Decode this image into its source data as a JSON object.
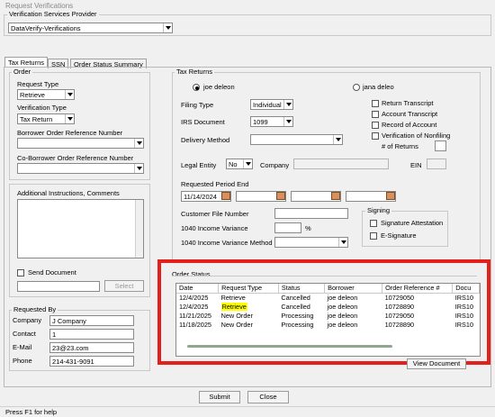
{
  "window": {
    "title": "Request Verifications"
  },
  "provider": {
    "label": "Verification Services Provider",
    "value": "DataVerify-Verifications"
  },
  "tabs": [
    {
      "label": "Tax Returns"
    },
    {
      "label": "SSN"
    },
    {
      "label": "Order Status Summary"
    }
  ],
  "order": {
    "group_label": "Order",
    "request_type_label": "Request Type",
    "request_type_value": "Retrieve",
    "verification_type_label": "Verification Type",
    "verification_type_value": "Tax Return",
    "borrower_ref_label": "Borrower Order Reference Number",
    "borrower_ref_value": "",
    "coborrower_ref_label": "Co-Borrower Order Reference Number",
    "coborrower_ref_value": ""
  },
  "instructions": {
    "label": "Additional Instructions, Comments",
    "send_document_label": "Send Document",
    "select_label": "Select"
  },
  "requested_by": {
    "label": "Requested By",
    "company_label": "Company",
    "company_value": "J Company",
    "contact_label": "Contact",
    "contact_value": "1",
    "email_label": "E-Mail",
    "email_value": "23@23.com",
    "phone_label": "Phone",
    "phone_value": "214-431-9091"
  },
  "tax_returns": {
    "group_label": "Tax Returns",
    "borrower1": "joe  deleon",
    "borrower2": "jana  deleo",
    "filing_type_label": "Filing Type",
    "filing_type_value": "Individual",
    "irs_document_label": "IRS Document",
    "irs_document_value": "1099",
    "delivery_method_label": "Delivery Method",
    "delivery_method_value": "",
    "legal_entity_label": "Legal Entity",
    "legal_entity_value": "No",
    "company_label": "Company",
    "ein_label": "EIN",
    "period_end_label": "Requested Period End",
    "period_end_value": "11/14/2024",
    "customer_file_label": "Customer File Number",
    "income_variance_label": "1040 Income Variance",
    "percent_label": "%",
    "variance_method_label": "1040 Income Variance Method",
    "checks": [
      "Return Transcript",
      "Account Transcript",
      "Record of Account",
      "Verification of Nonfiling"
    ],
    "num_returns_label": "# of Returns",
    "signing_label": "Signing",
    "signing_checks": [
      "Signature Attestation",
      "E-Signature"
    ]
  },
  "order_status": {
    "label": "Order Status",
    "columns": [
      "Date",
      "Request Type",
      "Status",
      "Borrower",
      "Order Reference #",
      "Docu"
    ],
    "rows": [
      [
        "12/4/2025",
        "Retrieve",
        "Cancelled",
        "joe deleon",
        "10729050",
        "IRS10"
      ],
      [
        "12/4/2025",
        "Retrieve",
        "Cancelled",
        "joe deleon",
        "10728890",
        "IRS10"
      ],
      [
        "11/21/2025",
        "New Order",
        "Processing",
        "joe deleon",
        "10729050",
        "IRS10"
      ],
      [
        "11/18/2025",
        "New Order",
        "Processing",
        "joe deleon",
        "10728890",
        "IRS10"
      ]
    ],
    "highlight_color": "#ffff00",
    "view_document_label": "View Document"
  },
  "footer": {
    "submit_label": "Submit",
    "close_label": "Close",
    "status": "Press F1 for help"
  },
  "colors": {
    "annotation_box": "#e4201c"
  }
}
